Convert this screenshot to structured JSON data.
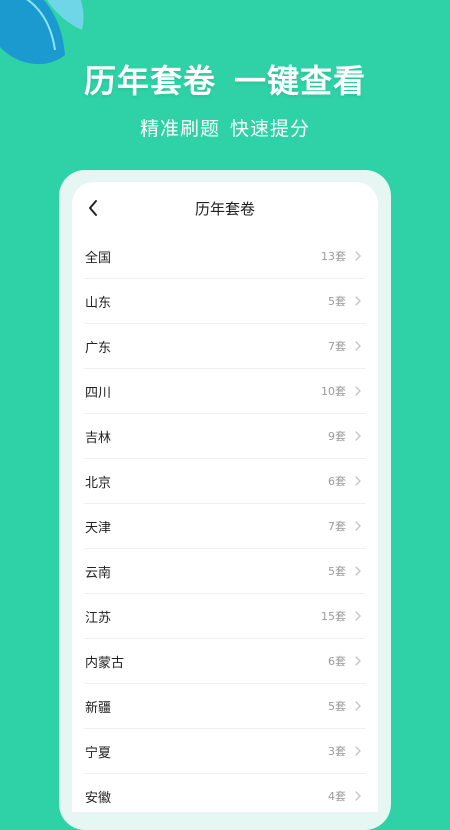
{
  "banner": {
    "headline_left": "历年套卷",
    "headline_right": "一键查看",
    "sub_left": "精准刷题",
    "sub_right": "快速提分"
  },
  "screen": {
    "title": "历年套卷",
    "back_icon": "chevron-left-icon",
    "arrow_icon": "chevron-right-icon",
    "items": [
      {
        "name": "全国",
        "count": "13套"
      },
      {
        "name": "山东",
        "count": "5套"
      },
      {
        "name": "广东",
        "count": "7套"
      },
      {
        "name": "四川",
        "count": "10套"
      },
      {
        "name": "吉林",
        "count": "9套"
      },
      {
        "name": "北京",
        "count": "6套"
      },
      {
        "name": "天津",
        "count": "7套"
      },
      {
        "name": "云南",
        "count": "5套"
      },
      {
        "name": "江苏",
        "count": "15套"
      },
      {
        "name": "内蒙古",
        "count": "6套"
      },
      {
        "name": "新疆",
        "count": "5套"
      },
      {
        "name": "宁夏",
        "count": "3套"
      },
      {
        "name": "安徽",
        "count": "4套"
      }
    ]
  },
  "colors": {
    "background": "#2fd2a6",
    "leaf_dark": "#1b9ad0",
    "leaf_light": "#6fd6e8",
    "leaf_accent": "#ffb24d"
  }
}
